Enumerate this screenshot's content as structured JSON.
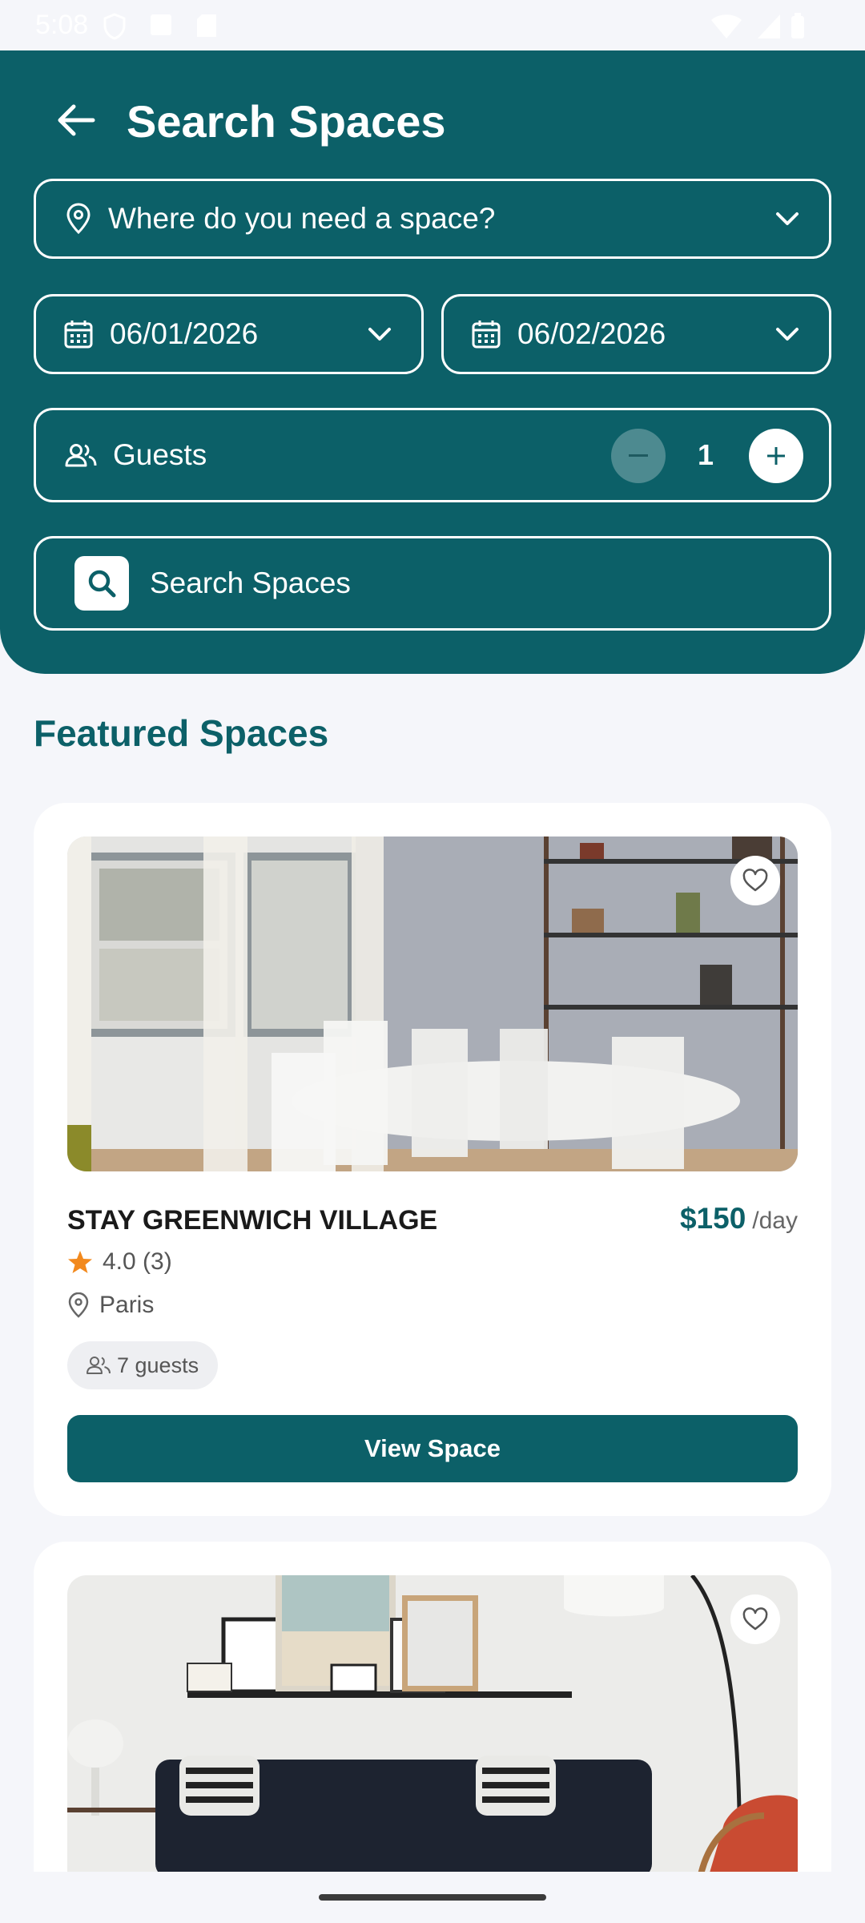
{
  "status_bar": {
    "time": "5:08"
  },
  "header": {
    "title": "Search Spaces",
    "location_placeholder": "Where do you need a space?",
    "start_date": "06/01/2026",
    "end_date": "06/02/2026",
    "guests_label": "Guests",
    "guest_count": "1",
    "search_button_label": "Search Spaces"
  },
  "featured": {
    "title": "Featured Spaces",
    "cards": [
      {
        "name": "STAY GREENWICH VILLAGE",
        "price": "$150",
        "price_unit": "/day",
        "rating": "4.0 (3)",
        "location": "Paris",
        "guests": "7 guests",
        "button_label": "View Space"
      }
    ]
  },
  "colors": {
    "primary": "#0c6068",
    "star": "#f2891d",
    "background": "#f5f6fa"
  }
}
